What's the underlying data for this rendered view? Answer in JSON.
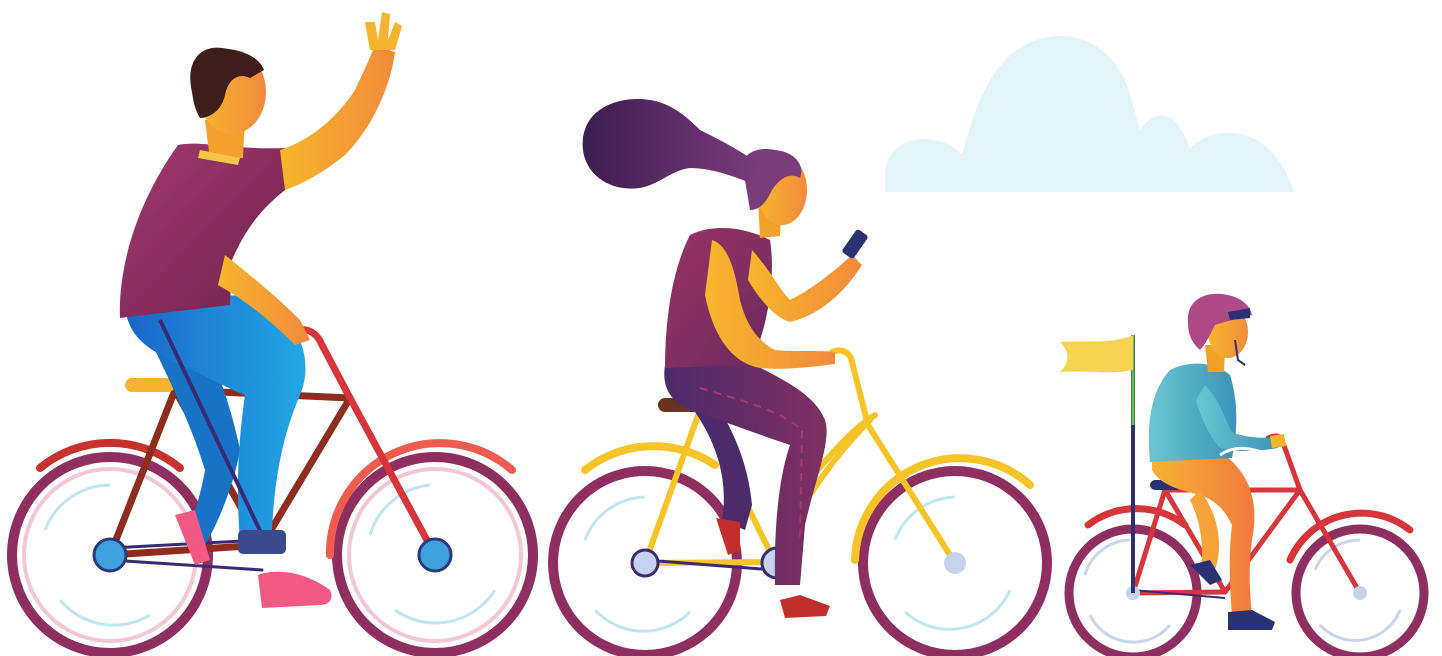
{
  "scene": {
    "background": "#ffffff",
    "elements": [
      "cloud",
      "father-cyclist",
      "mother-cyclist",
      "child-cyclist",
      "child-bike-flag"
    ]
  },
  "palette": {
    "cloud": "#e2f4f7",
    "father_shirt": "#8f2f5f",
    "father_pants": "#1e7fd1",
    "skin": "#f6b12f",
    "father_hair": "#3d1e1c",
    "father_bike_frame": "#8e2c1e",
    "father_bike_fork": "#d8353a",
    "mother_hair": "#5b2a6f",
    "mother_top": "#8a2f5d",
    "mother_pants": "#5c2b6d",
    "mother_bike_frame": "#f7c427",
    "child_helmet": "#b04a86",
    "child_shirt": "#4fb7c9",
    "child_pants": "#f6943a",
    "child_bike_frame": "#d8353a",
    "flag": "#f8d34f",
    "tire": "#8f2f5f",
    "rim": "#ffffff",
    "wheel_highlight": "#a9def0",
    "hub": "#3ea0dd"
  }
}
